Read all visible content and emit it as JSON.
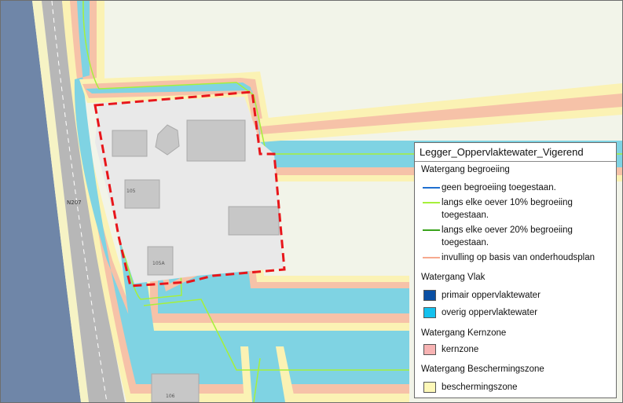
{
  "map": {
    "road_label": "N207",
    "house_labels": [
      "105",
      "105A",
      "106"
    ]
  },
  "legend": {
    "title": "Legger_Oppervlaktewater_Vigerend",
    "sections": [
      {
        "title": "Watergang begroeiing",
        "items": [
          {
            "label": "geen begroeiing toegestaan.",
            "symbol": "line",
            "color": "#1f6fd0"
          },
          {
            "label": "langs elke oever 10% begroeiing toegestaan.",
            "symbol": "line",
            "color": "#a6f03a"
          },
          {
            "label": "langs elke oever 20% begroeiing toegestaan.",
            "symbol": "line",
            "color": "#3aa31c"
          },
          {
            "label": "invulling op basis van onderhoudsplan",
            "symbol": "line",
            "color": "#f7a98e"
          }
        ]
      },
      {
        "title": "Watergang Vlak",
        "items": [
          {
            "label": "primair oppervlaktewater",
            "symbol": "fill",
            "color": "#0a4fa3"
          },
          {
            "label": "overig oppervlaktewater",
            "symbol": "fill",
            "color": "#14c1ee"
          }
        ]
      },
      {
        "title": "Watergang Kernzone",
        "items": [
          {
            "label": "kernzone",
            "symbol": "fill",
            "color": "#f7b3b3"
          }
        ]
      },
      {
        "title": "Watergang Beschermingszone",
        "items": [
          {
            "label": "beschermingszone",
            "symbol": "fill",
            "color": "#fdf8b8"
          }
        ]
      }
    ]
  },
  "colors": {
    "water": "#7fd3e3",
    "protection_zone": "#fbf2b4",
    "core_zone": "#f6c2a8",
    "land": "#f2f4e9",
    "road": "#b3b3b3",
    "canal": "#6f86a8",
    "boundary": "#e8161b"
  }
}
